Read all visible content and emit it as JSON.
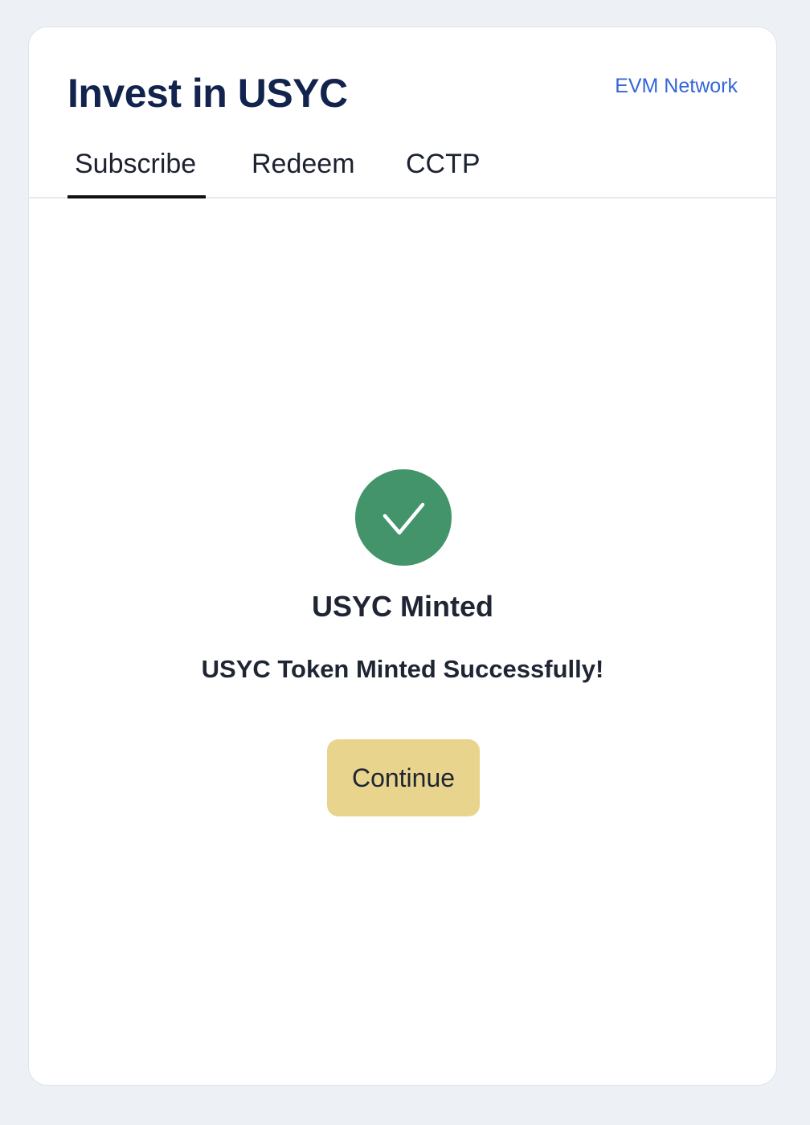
{
  "header": {
    "title": "Invest in USYC",
    "network_link": "EVM Network"
  },
  "tabs": [
    {
      "label": "Subscribe",
      "active": true
    },
    {
      "label": "Redeem",
      "active": false
    },
    {
      "label": "CCTP",
      "active": false
    }
  ],
  "status": {
    "icon": "checkmark-circle-icon",
    "title": "USYC Minted",
    "message": "USYC Token Minted Successfully!",
    "continue_label": "Continue"
  },
  "colors": {
    "page_background": "#edf0f4",
    "title": "#12244d",
    "link": "#3566d6",
    "success": "#43946a",
    "button": "#e8d48d",
    "text": "#1f2533"
  }
}
